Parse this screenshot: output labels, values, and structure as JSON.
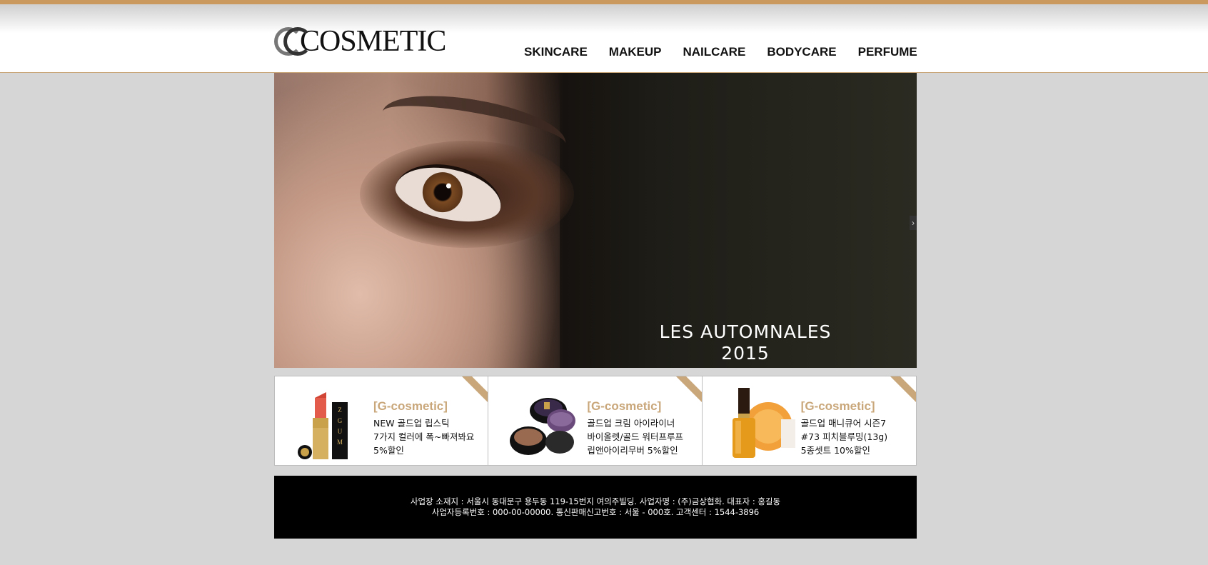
{
  "brand": {
    "logo_text": "COSMETIC"
  },
  "nav": {
    "items": [
      {
        "label": "SKINCARE"
      },
      {
        "label": "MAKEUP"
      },
      {
        "label": "NAILCARE"
      },
      {
        "label": "BODYCARE"
      },
      {
        "label": "PERFUME"
      }
    ]
  },
  "hero": {
    "caption_line1": "LES AUTOMNALES",
    "caption_line2": "2015",
    "next_glyph": "›"
  },
  "promos": [
    {
      "brand": "[G-cosmetic]",
      "lines": [
        "NEW 골드업 립스틱",
        "7가지 컬러에 폭~빠져봐요",
        "5%할인"
      ]
    },
    {
      "brand": "[G-cosmetic]",
      "lines": [
        "골드업 크림 아이라이너",
        "바이올렛/골드 워터프루프",
        "립앤아이리무버 5%할인"
      ]
    },
    {
      "brand": "[G-cosmetic]",
      "lines": [
        "골드업 매니큐어 시즌7",
        "#73 피치블루밍(13g)",
        "5종셋트 10%할인"
      ]
    }
  ],
  "footer": {
    "line1": "사업장 소재지 : 서울시 동대문구 용두동 119-15번지 여의주빌딩. 사업자명 : (주)금상협화. 대표자 : 홍길동",
    "line2": "사업자등록번호 : 000-00-00000. 통신판매신고번호 : 서울 - 000호. 고객센터 : 1544-3896"
  },
  "colors": {
    "accent": "#c9a77a",
    "background": "#d6d6d6",
    "footer_bg": "#000000"
  }
}
